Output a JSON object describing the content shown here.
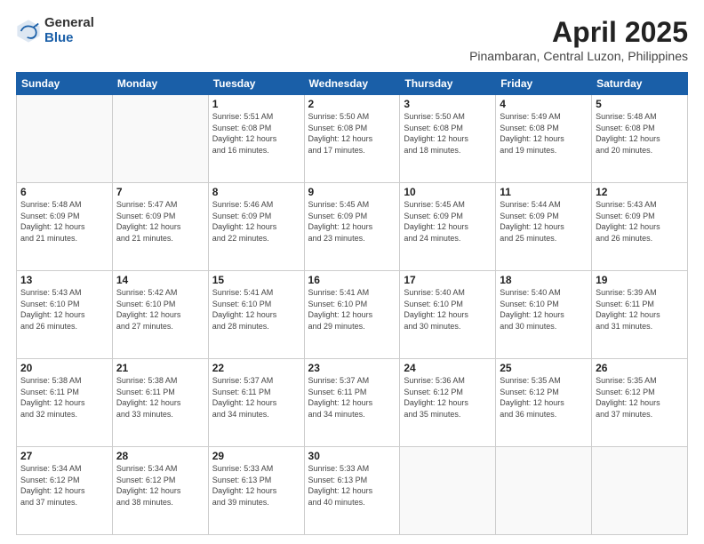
{
  "logo": {
    "general": "General",
    "blue": "Blue"
  },
  "header": {
    "title": "April 2025",
    "subtitle": "Pinambaran, Central Luzon, Philippines"
  },
  "weekdays": [
    "Sunday",
    "Monday",
    "Tuesday",
    "Wednesday",
    "Thursday",
    "Friday",
    "Saturday"
  ],
  "weeks": [
    [
      {
        "day": "",
        "info": ""
      },
      {
        "day": "",
        "info": ""
      },
      {
        "day": "1",
        "info": "Sunrise: 5:51 AM\nSunset: 6:08 PM\nDaylight: 12 hours\nand 16 minutes."
      },
      {
        "day": "2",
        "info": "Sunrise: 5:50 AM\nSunset: 6:08 PM\nDaylight: 12 hours\nand 17 minutes."
      },
      {
        "day": "3",
        "info": "Sunrise: 5:50 AM\nSunset: 6:08 PM\nDaylight: 12 hours\nand 18 minutes."
      },
      {
        "day": "4",
        "info": "Sunrise: 5:49 AM\nSunset: 6:08 PM\nDaylight: 12 hours\nand 19 minutes."
      },
      {
        "day": "5",
        "info": "Sunrise: 5:48 AM\nSunset: 6:08 PM\nDaylight: 12 hours\nand 20 minutes."
      }
    ],
    [
      {
        "day": "6",
        "info": "Sunrise: 5:48 AM\nSunset: 6:09 PM\nDaylight: 12 hours\nand 21 minutes."
      },
      {
        "day": "7",
        "info": "Sunrise: 5:47 AM\nSunset: 6:09 PM\nDaylight: 12 hours\nand 21 minutes."
      },
      {
        "day": "8",
        "info": "Sunrise: 5:46 AM\nSunset: 6:09 PM\nDaylight: 12 hours\nand 22 minutes."
      },
      {
        "day": "9",
        "info": "Sunrise: 5:45 AM\nSunset: 6:09 PM\nDaylight: 12 hours\nand 23 minutes."
      },
      {
        "day": "10",
        "info": "Sunrise: 5:45 AM\nSunset: 6:09 PM\nDaylight: 12 hours\nand 24 minutes."
      },
      {
        "day": "11",
        "info": "Sunrise: 5:44 AM\nSunset: 6:09 PM\nDaylight: 12 hours\nand 25 minutes."
      },
      {
        "day": "12",
        "info": "Sunrise: 5:43 AM\nSunset: 6:09 PM\nDaylight: 12 hours\nand 26 minutes."
      }
    ],
    [
      {
        "day": "13",
        "info": "Sunrise: 5:43 AM\nSunset: 6:10 PM\nDaylight: 12 hours\nand 26 minutes."
      },
      {
        "day": "14",
        "info": "Sunrise: 5:42 AM\nSunset: 6:10 PM\nDaylight: 12 hours\nand 27 minutes."
      },
      {
        "day": "15",
        "info": "Sunrise: 5:41 AM\nSunset: 6:10 PM\nDaylight: 12 hours\nand 28 minutes."
      },
      {
        "day": "16",
        "info": "Sunrise: 5:41 AM\nSunset: 6:10 PM\nDaylight: 12 hours\nand 29 minutes."
      },
      {
        "day": "17",
        "info": "Sunrise: 5:40 AM\nSunset: 6:10 PM\nDaylight: 12 hours\nand 30 minutes."
      },
      {
        "day": "18",
        "info": "Sunrise: 5:40 AM\nSunset: 6:10 PM\nDaylight: 12 hours\nand 30 minutes."
      },
      {
        "day": "19",
        "info": "Sunrise: 5:39 AM\nSunset: 6:11 PM\nDaylight: 12 hours\nand 31 minutes."
      }
    ],
    [
      {
        "day": "20",
        "info": "Sunrise: 5:38 AM\nSunset: 6:11 PM\nDaylight: 12 hours\nand 32 minutes."
      },
      {
        "day": "21",
        "info": "Sunrise: 5:38 AM\nSunset: 6:11 PM\nDaylight: 12 hours\nand 33 minutes."
      },
      {
        "day": "22",
        "info": "Sunrise: 5:37 AM\nSunset: 6:11 PM\nDaylight: 12 hours\nand 34 minutes."
      },
      {
        "day": "23",
        "info": "Sunrise: 5:37 AM\nSunset: 6:11 PM\nDaylight: 12 hours\nand 34 minutes."
      },
      {
        "day": "24",
        "info": "Sunrise: 5:36 AM\nSunset: 6:12 PM\nDaylight: 12 hours\nand 35 minutes."
      },
      {
        "day": "25",
        "info": "Sunrise: 5:35 AM\nSunset: 6:12 PM\nDaylight: 12 hours\nand 36 minutes."
      },
      {
        "day": "26",
        "info": "Sunrise: 5:35 AM\nSunset: 6:12 PM\nDaylight: 12 hours\nand 37 minutes."
      }
    ],
    [
      {
        "day": "27",
        "info": "Sunrise: 5:34 AM\nSunset: 6:12 PM\nDaylight: 12 hours\nand 37 minutes."
      },
      {
        "day": "28",
        "info": "Sunrise: 5:34 AM\nSunset: 6:12 PM\nDaylight: 12 hours\nand 38 minutes."
      },
      {
        "day": "29",
        "info": "Sunrise: 5:33 AM\nSunset: 6:13 PM\nDaylight: 12 hours\nand 39 minutes."
      },
      {
        "day": "30",
        "info": "Sunrise: 5:33 AM\nSunset: 6:13 PM\nDaylight: 12 hours\nand 40 minutes."
      },
      {
        "day": "",
        "info": ""
      },
      {
        "day": "",
        "info": ""
      },
      {
        "day": "",
        "info": ""
      }
    ]
  ]
}
